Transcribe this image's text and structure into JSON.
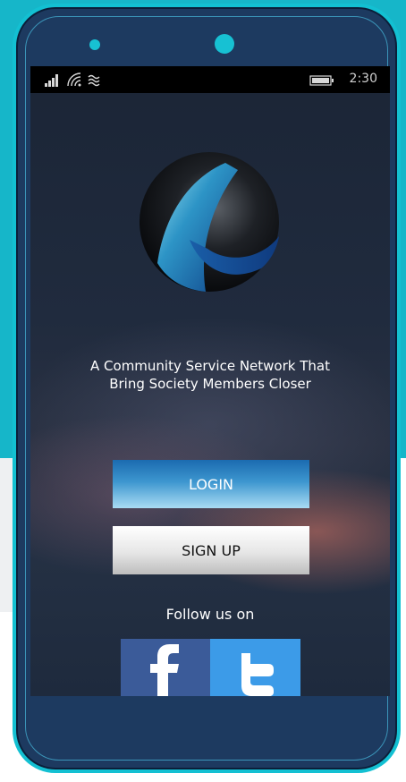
{
  "status_bar": {
    "time": "2:30",
    "icons": [
      "signal-icon",
      "wifi-icon",
      "network-icon",
      "battery-icon"
    ]
  },
  "logo": {
    "icon": "app-logo-icon"
  },
  "tagline": {
    "line1": "A Community Service Network That",
    "line2": "Bring Society Members Closer"
  },
  "buttons": {
    "login_label": "LOGIN",
    "signup_label": "SIGN UP"
  },
  "social": {
    "follow_label": "Follow us on",
    "icons": [
      "facebook-icon",
      "twitter-icon"
    ]
  },
  "colors": {
    "frame_accent": "#13c0d2",
    "frame_body": "#1d3a60",
    "login_blue": "#3d96cf",
    "facebook": "#3b5b99",
    "twitter": "#3c9be8"
  }
}
